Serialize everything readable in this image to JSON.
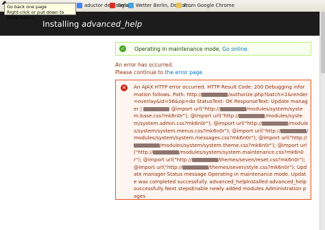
{
  "bookmarks": [
    {
      "label": "aductor de Google",
      "color": "#4285f4",
      "icon": "google-icon"
    },
    {
      "label": "Gmail",
      "color": "#d93025",
      "icon": "gmail-icon"
    },
    {
      "label": "Wetter Berlin, Deutsc...",
      "color": "#4aa3df",
      "icon": "weather-icon"
    },
    {
      "label": "From Google Chrome",
      "color": "#e8c35b",
      "icon": "folder-icon"
    }
  ],
  "tooltip": {
    "line1": "Go back one page",
    "line2": "Right-click or pull down to show history"
  },
  "header": {
    "title_prefix": "Installing ",
    "title_module": "advanced_help"
  },
  "status": {
    "message": "Operating in maintenance mode.",
    "link": "Go online."
  },
  "error_note": {
    "line1": "An error has occurred.",
    "line2_prefix": "Please continue to ",
    "line2_link": "the error page"
  },
  "error_parts": [
    "An AJAX HTTP error occurred. HTTP Result Code: 200 Debugging information follows. Path: http://",
    "/authorize.php?batch=1&render=overlay&id=56&op=do StatusText: OK ResponseText: Update manager | ",
    " @import url(\"http://",
    "/modules/system/system.base.css?mk6n0r\"); @import url(\"http://",
    "/modules/system/system.admin.css?mk6n0r\"); @import url(\"http://",
    "/modules/system/system.menus.css?mk6n0r\"); @import url(\"http://",
    "/modules/system/system.messages.css?mk6n0r\"); @import url(\"http://",
    "/modules/system/system.theme.css?mk6n0r\"); @import url(\"http://",
    "/modules/system/system.maintenance.css?mk6n0r\"); @import url(\"http://",
    "/themes/seven/reset.css?mk6n0r\"); @import url(\"http://",
    "/themes/seven/style.css?mk6n0r\"); Update manager Status message Operating in maintenance mode. Update was completed successfully. advanced_helpInstalled advanced_help successfully Next stepsEnable newly added modules Administration pages"
  ],
  "colors": {
    "header_bg": "#1c1c1c",
    "ok_border": "#bbee77",
    "error_border": "#ed541d",
    "link": "#0074bd"
  }
}
